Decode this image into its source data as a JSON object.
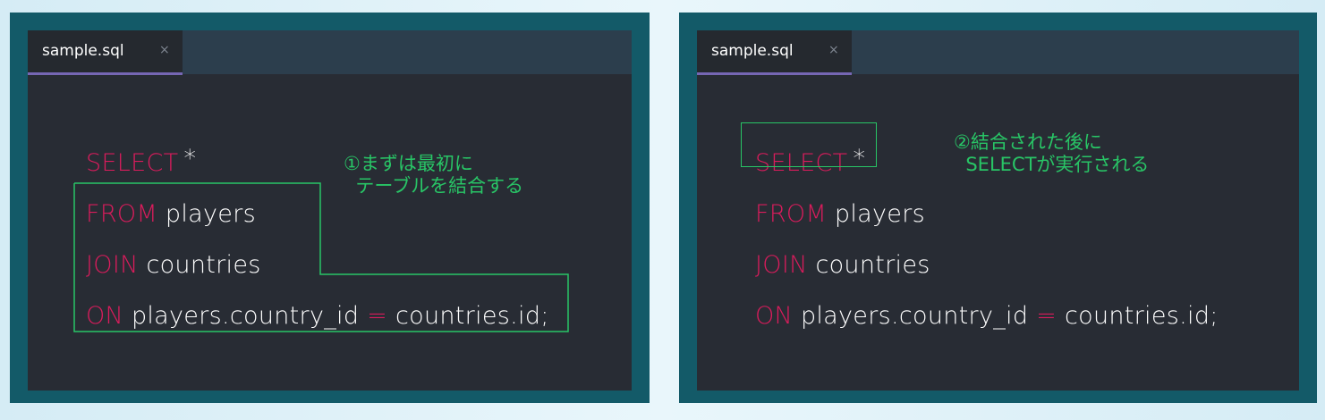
{
  "panels": [
    {
      "tab": {
        "label": "sample.sql",
        "close": "×"
      },
      "code": {
        "line1": {
          "kw": "SELECT",
          "rest": "*"
        },
        "line2": {
          "kw": "FROM",
          "rest": " players"
        },
        "line3": {
          "kw": "JOIN",
          "rest": " countries"
        },
        "line4": {
          "kw": "ON",
          "rest_a": " players.country_id ",
          "op": "=",
          "rest_b": " countries.id;"
        }
      },
      "annotation": "①まずは最初に\n  テーブルを結合する"
    },
    {
      "tab": {
        "label": "sample.sql",
        "close": "×"
      },
      "code": {
        "line1": {
          "kw": "SELECT",
          "rest": "*"
        },
        "line2": {
          "kw": "FROM",
          "rest": " players"
        },
        "line3": {
          "kw": "JOIN",
          "rest": " countries"
        },
        "line4": {
          "kw": "ON",
          "rest_a": " players.country_id ",
          "op": "=",
          "rest_b": " countries.id;"
        }
      },
      "annotation": "②結合された後に\n  SELECTが実行される"
    }
  ],
  "colors": {
    "keyword": "#d91c5c",
    "annotation": "#28c566",
    "editor_bg": "#282c34",
    "frame": "#135a68",
    "tab_underline": "#7667b4"
  }
}
